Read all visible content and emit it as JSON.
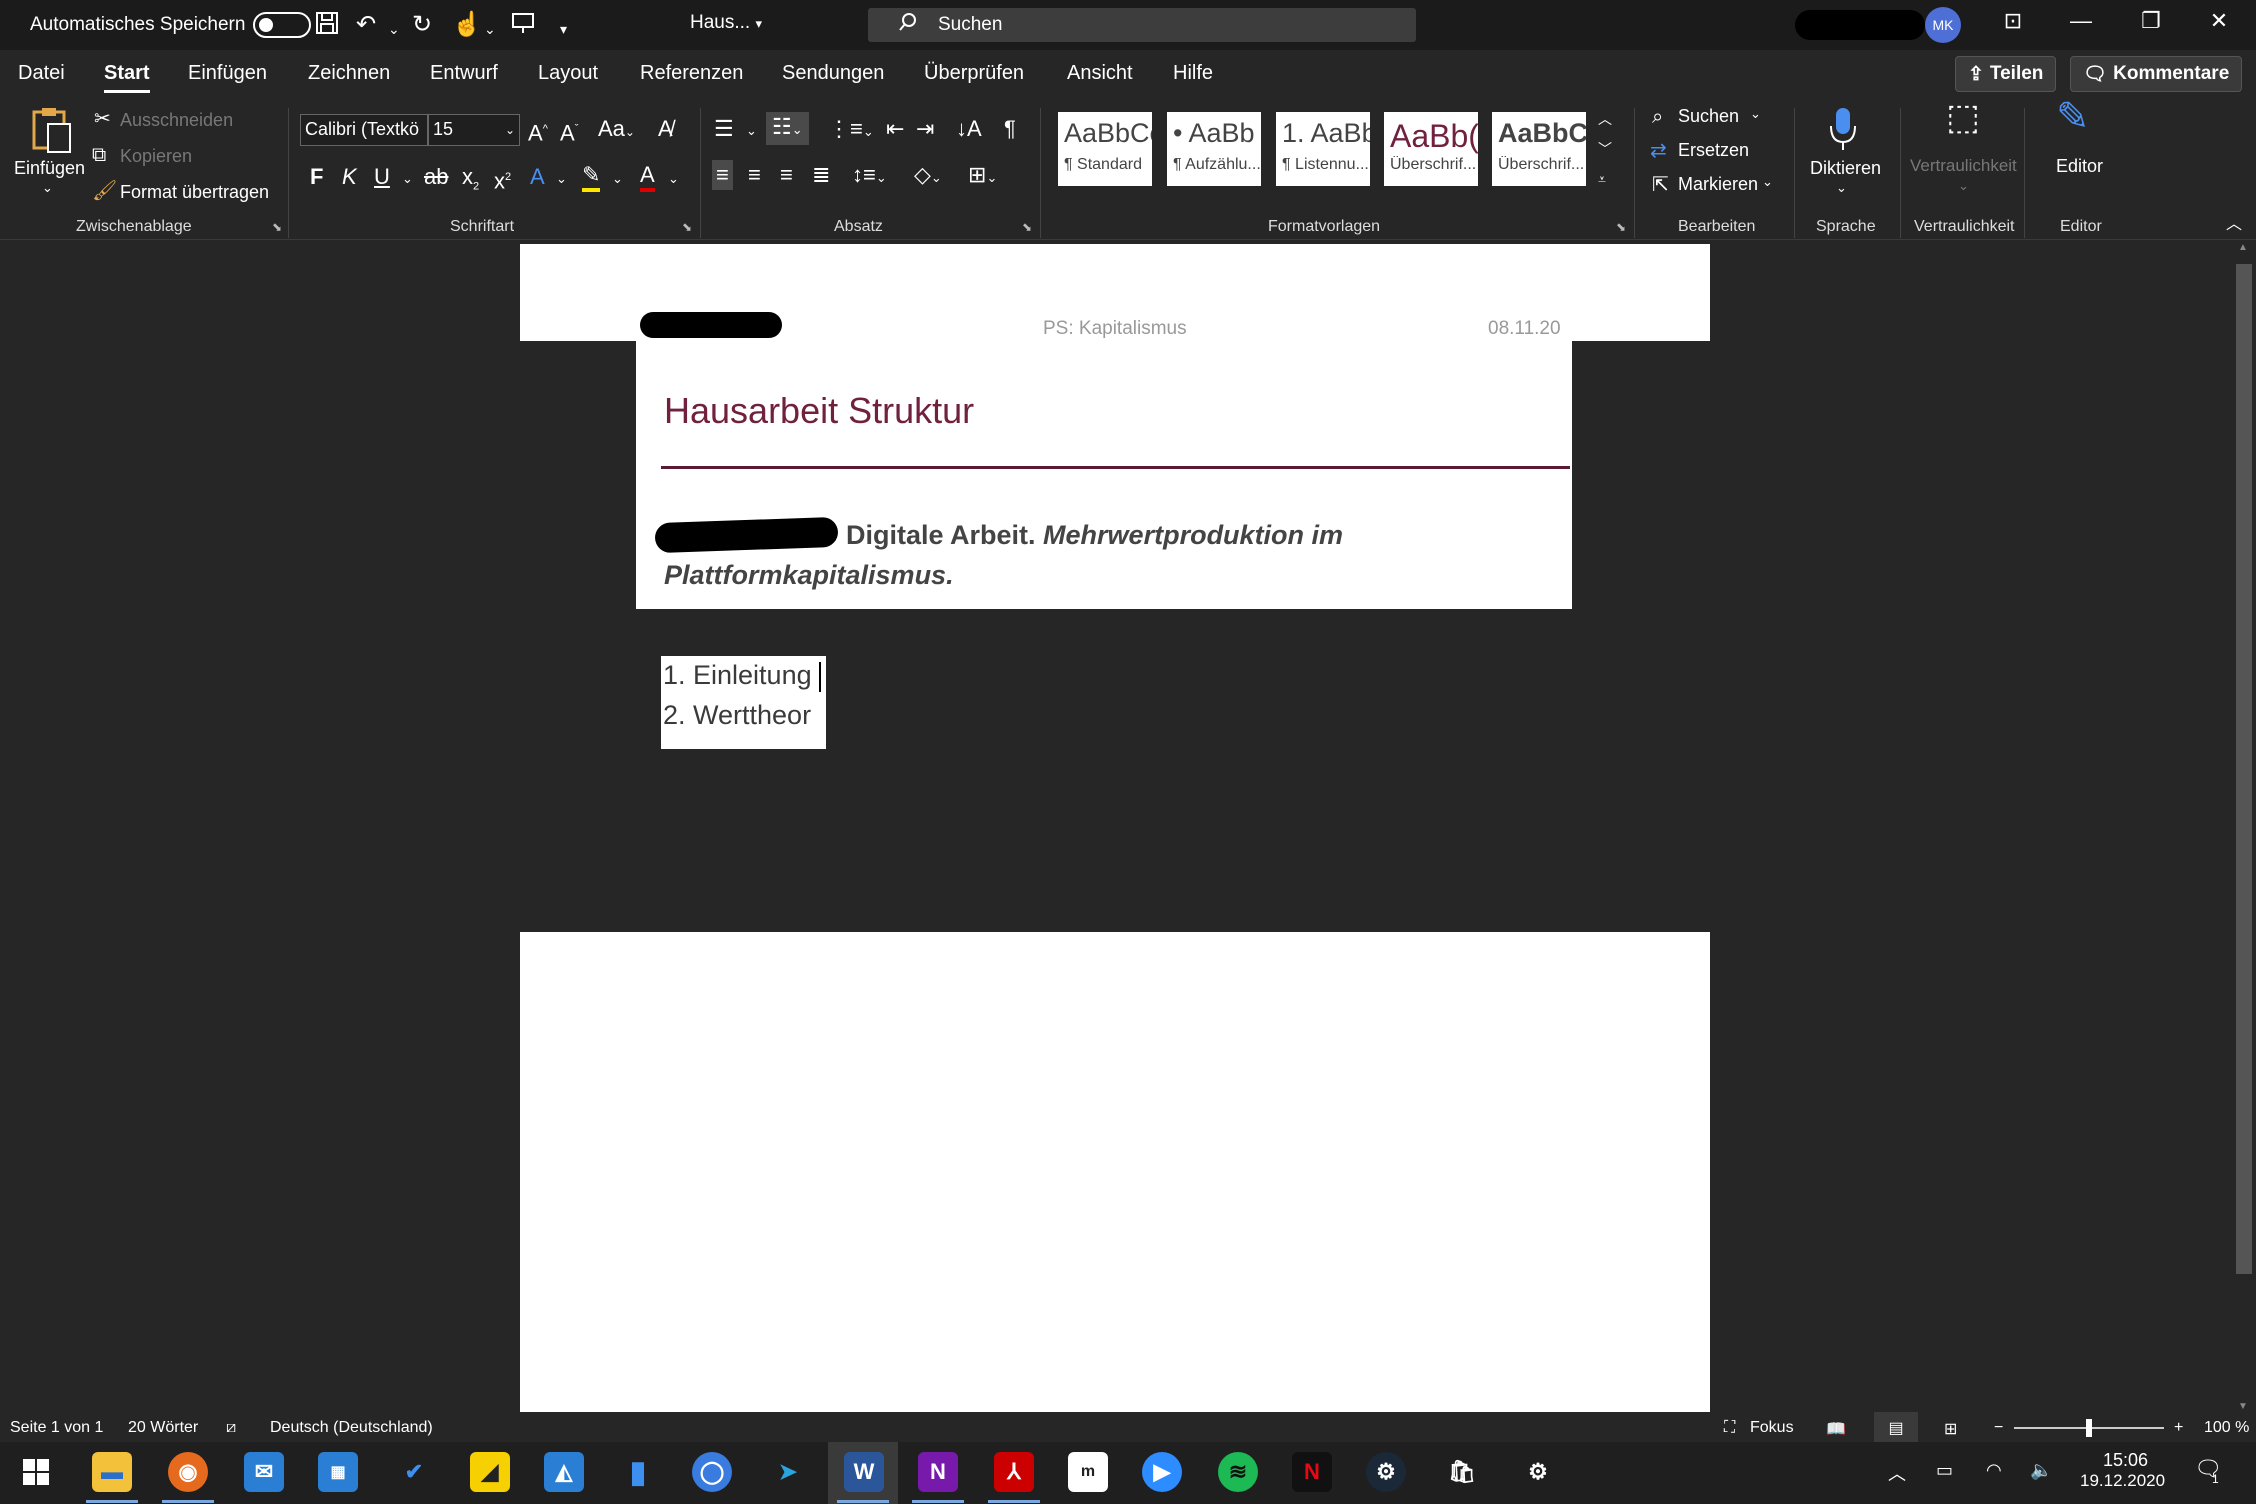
{
  "titlebar": {
    "autosave_label": "Automatisches Speichern",
    "doc_name": "Haus...",
    "search_placeholder": "Suchen",
    "avatar_initials": "MK"
  },
  "tabs": [
    "Datei",
    "Start",
    "Einfügen",
    "Zeichnen",
    "Entwurf",
    "Layout",
    "Referenzen",
    "Sendungen",
    "Überprüfen",
    "Ansicht",
    "Hilfe"
  ],
  "active_tab": "Start",
  "share_label": "Teilen",
  "comments_label": "Kommentare",
  "ribbon": {
    "clipboard": {
      "paste": "Einfügen",
      "cut": "Ausschneiden",
      "copy": "Kopieren",
      "format_painter": "Format übertragen",
      "group": "Zwischenablage"
    },
    "font": {
      "family": "Calibri (Textkö",
      "size": "15",
      "bold": "F",
      "italic": "K",
      "underline": "U",
      "group": "Schriftart"
    },
    "paragraph": {
      "group": "Absatz"
    },
    "styles": {
      "tiles": [
        {
          "preview": "AaBbCc",
          "name": "¶ Standard"
        },
        {
          "preview": "• AaBb",
          "name": "¶ Aufzählu..."
        },
        {
          "preview": "1. AaBb",
          "name": "¶ Listennu..."
        },
        {
          "preview": "AaBb(",
          "name": "Überschrif..."
        },
        {
          "preview": "AaBbCc",
          "name": "Überschrif..."
        }
      ],
      "group": "Formatvorlagen"
    },
    "editing": {
      "find": "Suchen",
      "replace": "Ersetzen",
      "select": "Markieren",
      "group": "Bearbeiten"
    },
    "voice": {
      "dictate": "Diktieren",
      "group": "Sprache"
    },
    "sensitivity": {
      "label": "Vertraulichkeit",
      "group": "Vertraulichkeit"
    },
    "editor": {
      "label": "Editor",
      "group": "Editor"
    }
  },
  "document": {
    "header_center": "PS: Kapitalismus",
    "header_date": "08.11.20",
    "title": "Hausarbeit Struktur",
    "subtitle_bold": "Digitale Arbeit.",
    "subtitle_italic_1": "Mehrwertproduktion im",
    "subtitle_italic_2": "Plattformkapitalismus.",
    "list": [
      "1.  Einleitung",
      "2.  Werttheor"
    ]
  },
  "status": {
    "page": "Seite 1 von 1",
    "words": "20 Wörter",
    "language": "Deutsch (Deutschland)",
    "focus": "Fokus",
    "zoom": "100 %",
    "zoom_level": 0.5
  },
  "taskbar": {
    "time": "15:06",
    "date": "19.12.2020",
    "notifications": "1"
  },
  "colors": {
    "title": "#70213e",
    "accent": "#4d6fd6",
    "ribbon_bg": "#262626"
  }
}
